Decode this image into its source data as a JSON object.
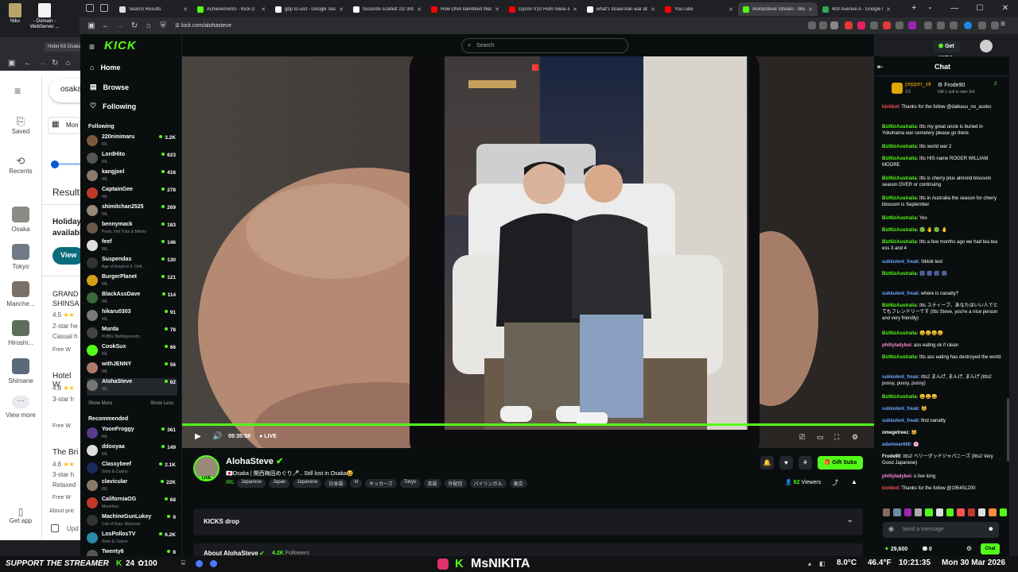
{
  "desktop": {
    "icons": [
      {
        "label": "Niko"
      },
      {
        "label": "- Domain - WebServer ..."
      }
    ]
  },
  "browser": {
    "tabs": [
      {
        "label": "Search Results",
        "color": "#ddd"
      },
      {
        "label": "Achievements - Kick D",
        "color": "#53fc18"
      },
      {
        "label": "gbp to usd - Google Sear",
        "color": "#fff"
      },
      {
        "label": "focusrite scarlett 2i2 3rd g",
        "color": "#fff"
      },
      {
        "label": "How DNA Identified Walke",
        "color": "#ff0000"
      },
      {
        "label": "Dyson V10 Hum noise and",
        "color": "#ff0000"
      },
      {
        "label": "what's Israel-Iran war abo",
        "color": "#fff"
      },
      {
        "label": "YouTube",
        "color": "#ff0000"
      },
      {
        "label": "AlohaSteve Stream - Watc",
        "color": "#53fc18",
        "active": true
      },
      {
        "label": "400 Avenue A - Google M",
        "color": "#34a853"
      }
    ],
    "url": "kick.com/alohasteve",
    "win_controls": [
      "—",
      "☐",
      "✕"
    ]
  },
  "maps": {
    "tab_label": "Hotel K8 Osaka",
    "search_value": "osaka",
    "nav": [
      {
        "label": "Saved"
      },
      {
        "label": "Recents"
      },
      {
        "label": "Osaka"
      },
      {
        "label": "Tokyo"
      },
      {
        "label": "Manche..."
      },
      {
        "label": "Hiroshi..."
      },
      {
        "label": "Shimane"
      },
      {
        "label": "View more"
      },
      {
        "label": "Get app"
      }
    ],
    "date_label": "Mon",
    "results_label": "Result",
    "holiday_text": "Holiday available",
    "view_btn": "View",
    "listings": [
      {
        "name": "GRAND SHINSA",
        "rating": "4.5",
        "type": "2-star he",
        "desc": "Casual h",
        "wifi": "Free W"
      },
      {
        "name": "Hotel W",
        "rating": "4.8",
        "type": "3-star h",
        "desc": "",
        "wifi": "Free W"
      },
      {
        "name": "The Bri",
        "rating": "4.6",
        "type": "3-star h",
        "desc": "Relaxed",
        "wifi": "Free W"
      }
    ],
    "about": "About pric",
    "upd": "Upd"
  },
  "kick": {
    "logo": "KICK",
    "search_placeholder": "Search",
    "get_kicks": "Get KICKs",
    "nav": {
      "home": "Home",
      "browse": "Browse",
      "following": "Following"
    },
    "following_title": "Following",
    "following": [
      {
        "name": "220ninimaru",
        "cat": "IRL",
        "viewers": "3.2K",
        "color": "#7a5a3a"
      },
      {
        "name": "LordHito",
        "cat": "IRL",
        "viewers": "623",
        "color": "#555"
      },
      {
        "name": "kangjoel",
        "cat": "IRL",
        "viewers": "416",
        "color": "#8a7a6a"
      },
      {
        "name": "CaptainGee",
        "cat": "IRL",
        "viewers": "278",
        "color": "#c0392b"
      },
      {
        "name": "shimitchan2525",
        "cat": "IRL",
        "viewers": "269",
        "color": "#9a8a7a"
      },
      {
        "name": "bennymack",
        "cat": "Pools, Hot Tubs & Bikinis",
        "viewers": "183",
        "color": "#6a5a4a"
      },
      {
        "name": "feef",
        "cat": "IRL",
        "viewers": "146",
        "color": "#e0e0e0"
      },
      {
        "name": "Suspendas",
        "cat": "Age of Empires II: Defi...",
        "viewers": "130",
        "color": "#333"
      },
      {
        "name": "BurgerPlanet",
        "cat": "IRL",
        "viewers": "121",
        "color": "#d4a017"
      },
      {
        "name": "BlackAssDave",
        "cat": "IRL",
        "viewers": "114",
        "color": "#3a6a3a"
      },
      {
        "name": "hikaru0303",
        "cat": "IRL",
        "viewers": "91",
        "color": "#7a7a7a"
      },
      {
        "name": "Murda",
        "cat": "PUBG: Battlegrounds",
        "viewers": "78",
        "color": "#444"
      },
      {
        "name": "CookSux",
        "cat": "IRL",
        "viewers": "66",
        "color": "#53fc18"
      },
      {
        "name": "withJENNY",
        "cat": "IRL",
        "viewers": "56",
        "color": "#b07a6a"
      },
      {
        "name": "AlohaSteve",
        "cat": "IRL",
        "viewers": "62",
        "color": "#777",
        "active": true
      }
    ],
    "show_more": "Show More",
    "show_less": "Show Less",
    "recommended_title": "Recommended",
    "recommended": [
      {
        "name": "YoonFroggy",
        "cat": "IRL",
        "viewers": "361",
        "color": "#5a3a8a"
      },
      {
        "name": "ddooyaa",
        "cat": "IRL",
        "viewers": "149",
        "color": "#ddd"
      },
      {
        "name": "Classybeef",
        "cat": "Slots & Casino",
        "viewers": "2.1K",
        "color": "#1a2a5a"
      },
      {
        "name": "clavicular",
        "cat": "IRL",
        "viewers": "22K",
        "color": "#8a7a6a"
      },
      {
        "name": "CaliforniaOG",
        "cat": "Marathon",
        "viewers": "68",
        "color": "#c0392b"
      },
      {
        "name": "MachineGunLukey",
        "cat": "Call of Duty: Warzone",
        "viewers": "9",
        "color": "#333"
      },
      {
        "name": "LosPollosTV",
        "cat": "Slots & Casino",
        "viewers": "6.2K",
        "color": "#2a8aa8"
      },
      {
        "name": "Twenty6",
        "cat": "",
        "viewers": "8",
        "color": "#555"
      }
    ],
    "player": {
      "time": "09:35:58",
      "live": "LIVE",
      "progress": 1.0
    },
    "stream": {
      "channel": "AlohaSteve",
      "title": "🇯🇵Osaka | 関西梅田めぐり🎤.. Still lost in Osaka😆",
      "category": "IRL",
      "tags": [
        "Japanese",
        "Japan",
        "Japanese",
        "日本語",
        "irl",
        "キッカーズ",
        "Tokyo",
        "英語",
        "外配信",
        "バイリンガル",
        "東京"
      ],
      "viewers": "62",
      "viewers_label": "Viewers",
      "gift_subs": "Gift Subs",
      "live_badge": "LIVE"
    },
    "kicks_drop": "KICKS drop",
    "about_title": "About AlohaSteve",
    "followers": "4.2K",
    "followers_label": "Followers"
  },
  "chat": {
    "title": "Chat",
    "pinned": [
      {
        "name": "pepper_ok",
        "count": "10"
      },
      {
        "name": "Frode90",
        "count": "2",
        "sub": "Gift 1 sub to take 3rd"
      }
    ],
    "messages": [
      {
        "user": "kickbot",
        "color": "#ff4d4d",
        "text": "Thanks for the follow @daikasu_no_asoko"
      },
      {
        "user": "BizNizAustralia",
        "color": "#53fc18",
        "text": "Itts my great uncle is buried in Yokohama war cemetery please go there"
      },
      {
        "user": "BizNizAustralia",
        "color": "#53fc18",
        "text": "Itts world war 2"
      },
      {
        "user": "BizNizAustralia",
        "color": "#53fc18",
        "text": "Itts HIS name ROGER WILLIAM MOORE"
      },
      {
        "user": "BizNizAustralia",
        "color": "#53fc18",
        "text": "Itts is cherry plus almond blossom season OVER or continuing"
      },
      {
        "user": "BizNizAustralia",
        "color": "#53fc18",
        "text": "Itts in Australia the season for cherry blossom is September"
      },
      {
        "user": "BizNizAustralia",
        "color": "#53fc18",
        "text": "Yes"
      },
      {
        "user": "BizNizAustralia",
        "color": "#53fc18",
        "text": "🟢 🤚 🟢 🤚"
      },
      {
        "user": "BizNizAustralia",
        "color": "#53fc18",
        "text": "Itts a few months ago we had tea tea ess 3 and 4"
      },
      {
        "user": "sukkulent_freak",
        "color": "#6aa8ff",
        "text": "!tiktok test"
      },
      {
        "user": "BizNizAustralia",
        "color": "#53fc18",
        "text": "🎆 🎆 🎆 🎆"
      },
      {
        "user": "sukkulent_freak",
        "color": "#6aa8ff",
        "text": "where is nanatty?"
      },
      {
        "user": "BizNizAustralia",
        "color": "#53fc18",
        "text": "Itts スティーブ、あなたはいい人でとてもフレンドリーです (Itts Steve, you're a nice person and very friendly)"
      },
      {
        "user": "BizNizAustralia",
        "color": "#53fc18",
        "text": "😄😄😄😄"
      },
      {
        "user": "phillyladyboi",
        "color": "#ff8ad8",
        "text": "ass eating ok if clean"
      },
      {
        "user": "BizNizAustralia",
        "color": "#53fc18",
        "text": "Itts ass eating has destroyed the world"
      },
      {
        "user": "sukkulent_freak",
        "color": "#6aa8ff",
        "text": "Itts2 まんげ, まんげ, まんげ (Itts2 pussy, pussy, pussy)"
      },
      {
        "user": "BizNizAustralia",
        "color": "#53fc18",
        "text": "😄😄😄"
      },
      {
        "user": "sukkulent_freak",
        "color": "#6aa8ff",
        "text": "🐱"
      },
      {
        "user": "sukkulent_freak",
        "color": "#6aa8ff",
        "text": "find nanatty"
      },
      {
        "user": "omegetreez",
        "color": "#ffffff",
        "text": "🐱"
      },
      {
        "user": "adamwar666",
        "color": "#6aa8ff",
        "text": "🌸"
      },
      {
        "user": "Frode90",
        "color": "#ffffff",
        "text": "Itts2 ベリーグッドジャパニーズ (Itts2 Very Good Japanese)"
      },
      {
        "user": "phillyladyboi",
        "color": "#ff8ad8",
        "text": "u live long"
      },
      {
        "user": "kickbot",
        "color": "#ff4d4d",
        "text": "Thanks for the follow @195451200"
      }
    ],
    "input_placeholder": "Send a message",
    "points": "29,600",
    "coins": "0",
    "chat_btn": "Chat"
  },
  "overlay": {
    "support": "SUPPORT THE STREAMER",
    "kick_count": "24",
    "points": "100",
    "brand": "MsNIKITA",
    "temp": "8.0°C",
    "humidity": "46.4°F",
    "time": "10:21:35",
    "date": "Mon 30 Mar 2026"
  }
}
